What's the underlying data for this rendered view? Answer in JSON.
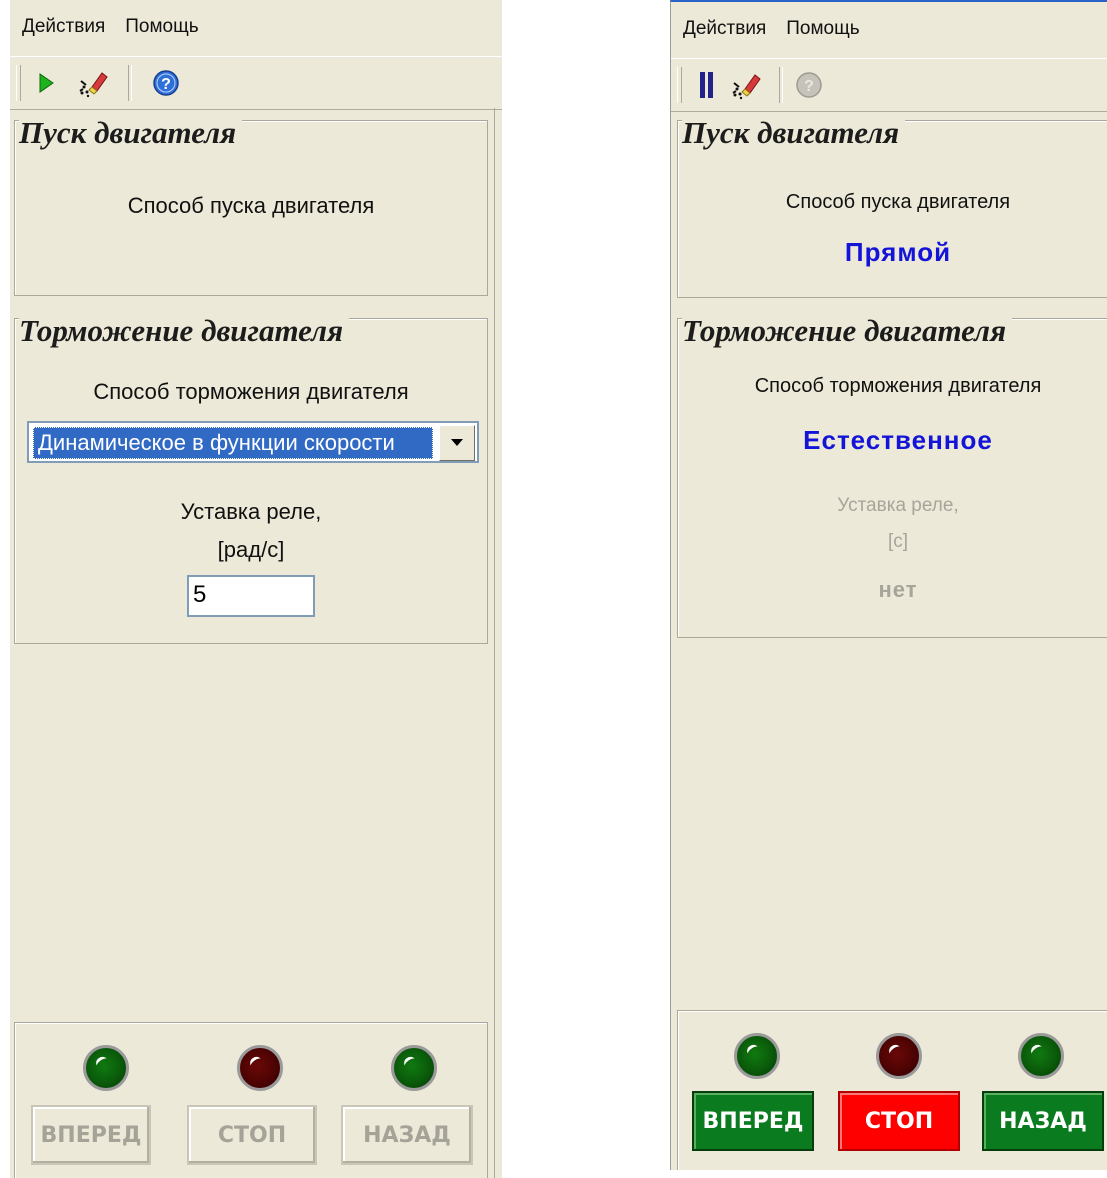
{
  "menu": [
    "Действия",
    "Помощь"
  ],
  "left": {
    "start_group": {
      "title": "Пуск двигателя",
      "method_label": "Способ пуска двигателя"
    },
    "brake_group": {
      "title": "Торможение двигателя",
      "method_label": "Способ торможения двигателя",
      "method_selected": "Динамическое в функции скорости",
      "relay_label": "Уставка реле,",
      "relay_unit": "[рад/с]",
      "relay_value": "5"
    },
    "controls": {
      "forward": "ВПЕРЕД",
      "stop": "СТОП",
      "back": "НАЗАД"
    }
  },
  "right": {
    "start_group": {
      "title": "Пуск двигателя",
      "method_label": "Способ пуска двигателя",
      "method_value": "Прямой"
    },
    "brake_group": {
      "title": "Торможение двигателя",
      "method_label": "Способ торможения двигателя",
      "method_value": "Естественное",
      "relay_label": "Уставка реле,",
      "relay_unit": "[c]",
      "relay_value": "нет"
    },
    "controls": {
      "forward": "ВПЕРЕД",
      "stop": "СТОП",
      "back": "НАЗАД"
    }
  },
  "colors": {
    "panel_bg": "#ece9d8",
    "value_blue": "#1414d8",
    "lamp_green": "#0a5a0a",
    "lamp_red": "#4d0303",
    "button_green": "#0b7b1f",
    "button_red": "#ff0000"
  },
  "icons": {
    "left_toolbar": [
      "play-icon",
      "clear-icon",
      "help-icon"
    ],
    "right_toolbar": [
      "pause-icon",
      "clear-icon",
      "help-disabled-icon"
    ]
  }
}
